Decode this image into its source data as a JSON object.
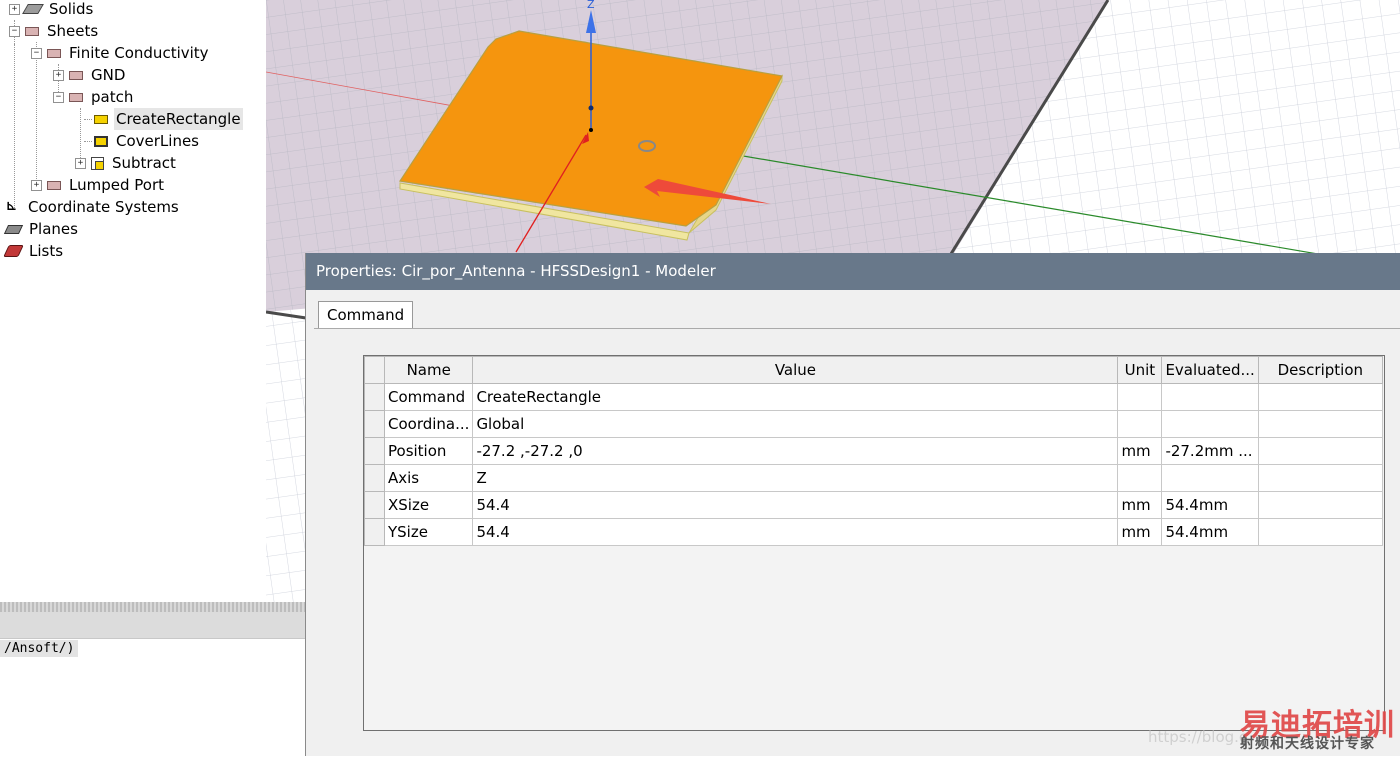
{
  "tree": {
    "solids": "Solids",
    "sheets": "Sheets",
    "finite_conductivity": "Finite Conductivity",
    "gnd": "GND",
    "patch": "patch",
    "create_rectangle": "CreateRectangle",
    "cover_lines": "CoverLines",
    "subtract": "Subtract",
    "lumped_port": "Lumped Port",
    "coordinate_systems": "Coordinate Systems",
    "planes": "Planes",
    "lists": "Lists"
  },
  "console": {
    "path": "/Ansoft/)"
  },
  "viewport": {
    "axis_z_label": "Z"
  },
  "properties": {
    "title": "Properties: Cir_por_Antenna - HFSSDesign1 - Modeler",
    "tab": "Command",
    "columns": [
      "Name",
      "Value",
      "Unit",
      "Evaluated...",
      "Description"
    ],
    "rows": [
      {
        "name": "Command",
        "value": "CreateRectangle",
        "unit": "",
        "evaluated": "",
        "description": ""
      },
      {
        "name": "Coordina...",
        "value": "Global",
        "unit": "",
        "evaluated": "",
        "description": ""
      },
      {
        "name": "Position",
        "value": "-27.2 ,-27.2 ,0",
        "unit": "mm",
        "evaluated": "-27.2mm ...",
        "description": ""
      },
      {
        "name": "Axis",
        "value": "Z",
        "unit": "",
        "evaluated": "",
        "description": ""
      },
      {
        "name": "XSize",
        "value": "54.4",
        "unit": "mm",
        "evaluated": "54.4mm",
        "description": ""
      },
      {
        "name": "YSize",
        "value": "54.4",
        "unit": "mm",
        "evaluated": "54.4mm",
        "description": ""
      }
    ]
  },
  "watermark": {
    "url": "https://blog.c",
    "brand": "易迪拓培训",
    "subtitle": "射频和天线设计专家"
  },
  "colors": {
    "patch": "#f5950e",
    "title_bar": "#68788a",
    "grid_plane": "#d9cfdb",
    "selection": "#f5d200",
    "arrow": "#ee4a3a"
  }
}
